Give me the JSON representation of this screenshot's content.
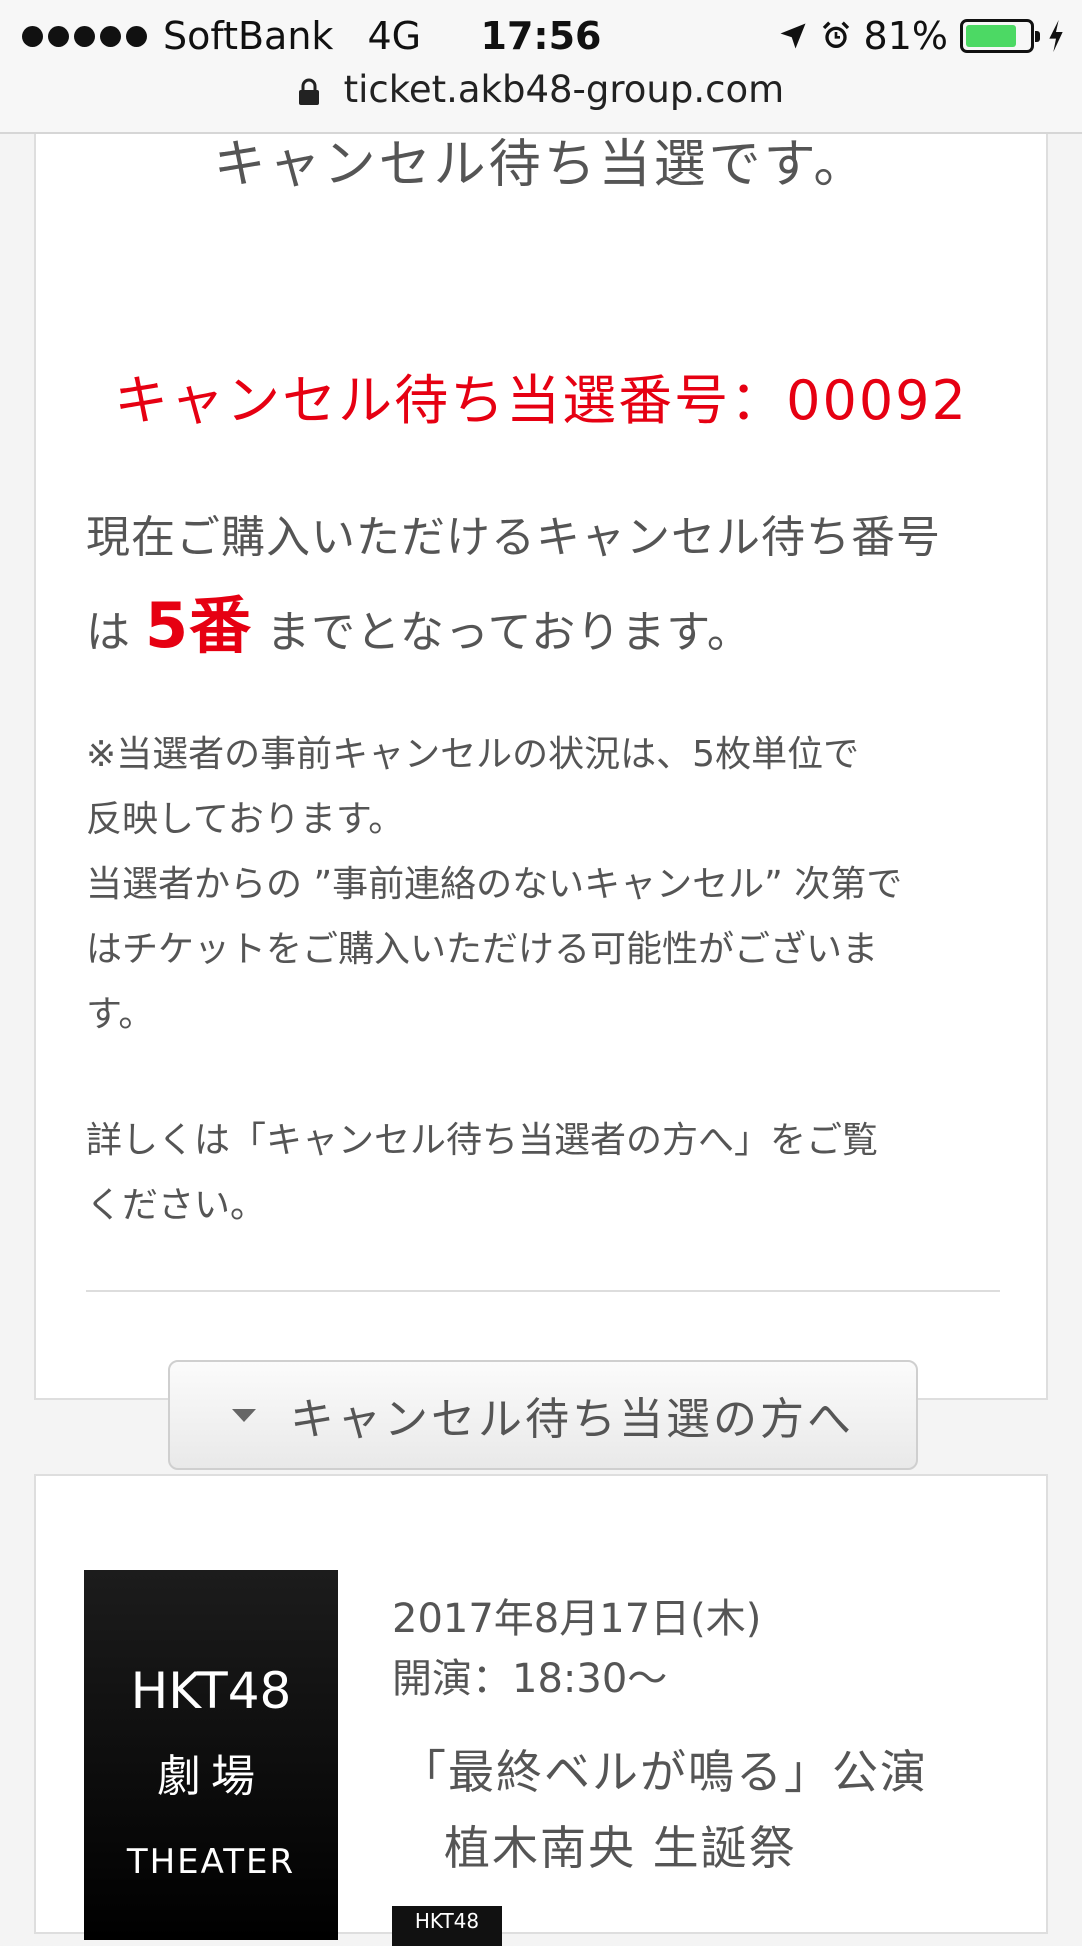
{
  "status_bar": {
    "carrier": "SoftBank",
    "network": "4G",
    "time": "17:56",
    "battery": "81%",
    "battery_level": 0.81,
    "icons": [
      "location-arrow-icon",
      "alarm-icon",
      "battery-icon",
      "charging-bolt-icon"
    ]
  },
  "browser": {
    "url": "ticket.akb48-group.com"
  },
  "result_card": {
    "heading": "キャンセル待ち当選です。",
    "win_number": "キャンセル待ち当選番号：00092",
    "purchase_line1": "現在ご購入いただけるキャンセル待ち番号",
    "purchase_prefix": "は",
    "purchase_number": "5番",
    "purchase_suffix": "までとなっております。",
    "note_lines": [
      "※当選者の事前キャンセルの状況は、5枚単位で",
      "反映しております。",
      "当選者からの ”事前連絡のないキャンセル” 次第で",
      "はチケットをご購入いただける可能性がございま",
      "す。"
    ],
    "details_lines": [
      "詳しくは「キャンセル待ち当選者の方へ」をご覧",
      "ください。"
    ],
    "cancel_button_label": "キャンセル待ち当選の方へ"
  },
  "show_card": {
    "logo_line1": "HKT48",
    "logo_line2": "劇場",
    "logo_line3": "THEATER",
    "date": "2017年8月17日(木)",
    "time": "開演：18:30〜",
    "title": "「最終ベルが鳴る」公演",
    "subtitle": "植木南央 生誕祭",
    "tag": "HKT48"
  },
  "colors": {
    "accent_red": "#e60012",
    "battery_green": "#4cd964"
  }
}
